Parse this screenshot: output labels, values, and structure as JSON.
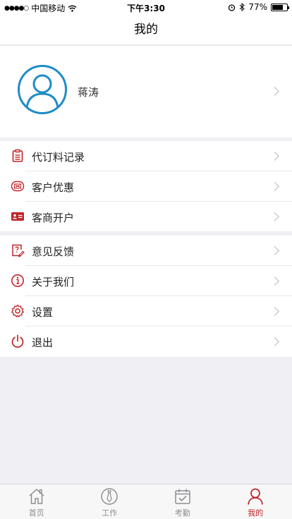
{
  "status_bar": {
    "carrier": "中国移动",
    "time": "下午3:30",
    "battery": "77%",
    "battery_level": 0.77
  },
  "nav": {
    "title": "我的"
  },
  "profile": {
    "name": "蒋涛"
  },
  "menu_group_1": [
    {
      "label": "代订料记录",
      "icon": "clipboard-icon"
    },
    {
      "label": "客户优惠",
      "icon": "coupon-icon"
    },
    {
      "label": "客商开户",
      "icon": "id-card-icon"
    }
  ],
  "menu_group_2": [
    {
      "label": "意见反馈",
      "icon": "feedback-icon"
    },
    {
      "label": "关于我们",
      "icon": "info-icon"
    },
    {
      "label": "设置",
      "icon": "gear-icon"
    },
    {
      "label": "退出",
      "icon": "power-icon"
    }
  ],
  "tabs": [
    {
      "label": "首页",
      "icon": "home-icon",
      "active": false
    },
    {
      "label": "工作",
      "icon": "tie-icon",
      "active": false
    },
    {
      "label": "考勤",
      "icon": "calendar-check-icon",
      "active": false
    },
    {
      "label": "我的",
      "icon": "person-icon",
      "active": true
    }
  ],
  "colors": {
    "accent": "#c0242a",
    "avatar_blue": "#1e8cc6",
    "background": "#efeff4"
  }
}
